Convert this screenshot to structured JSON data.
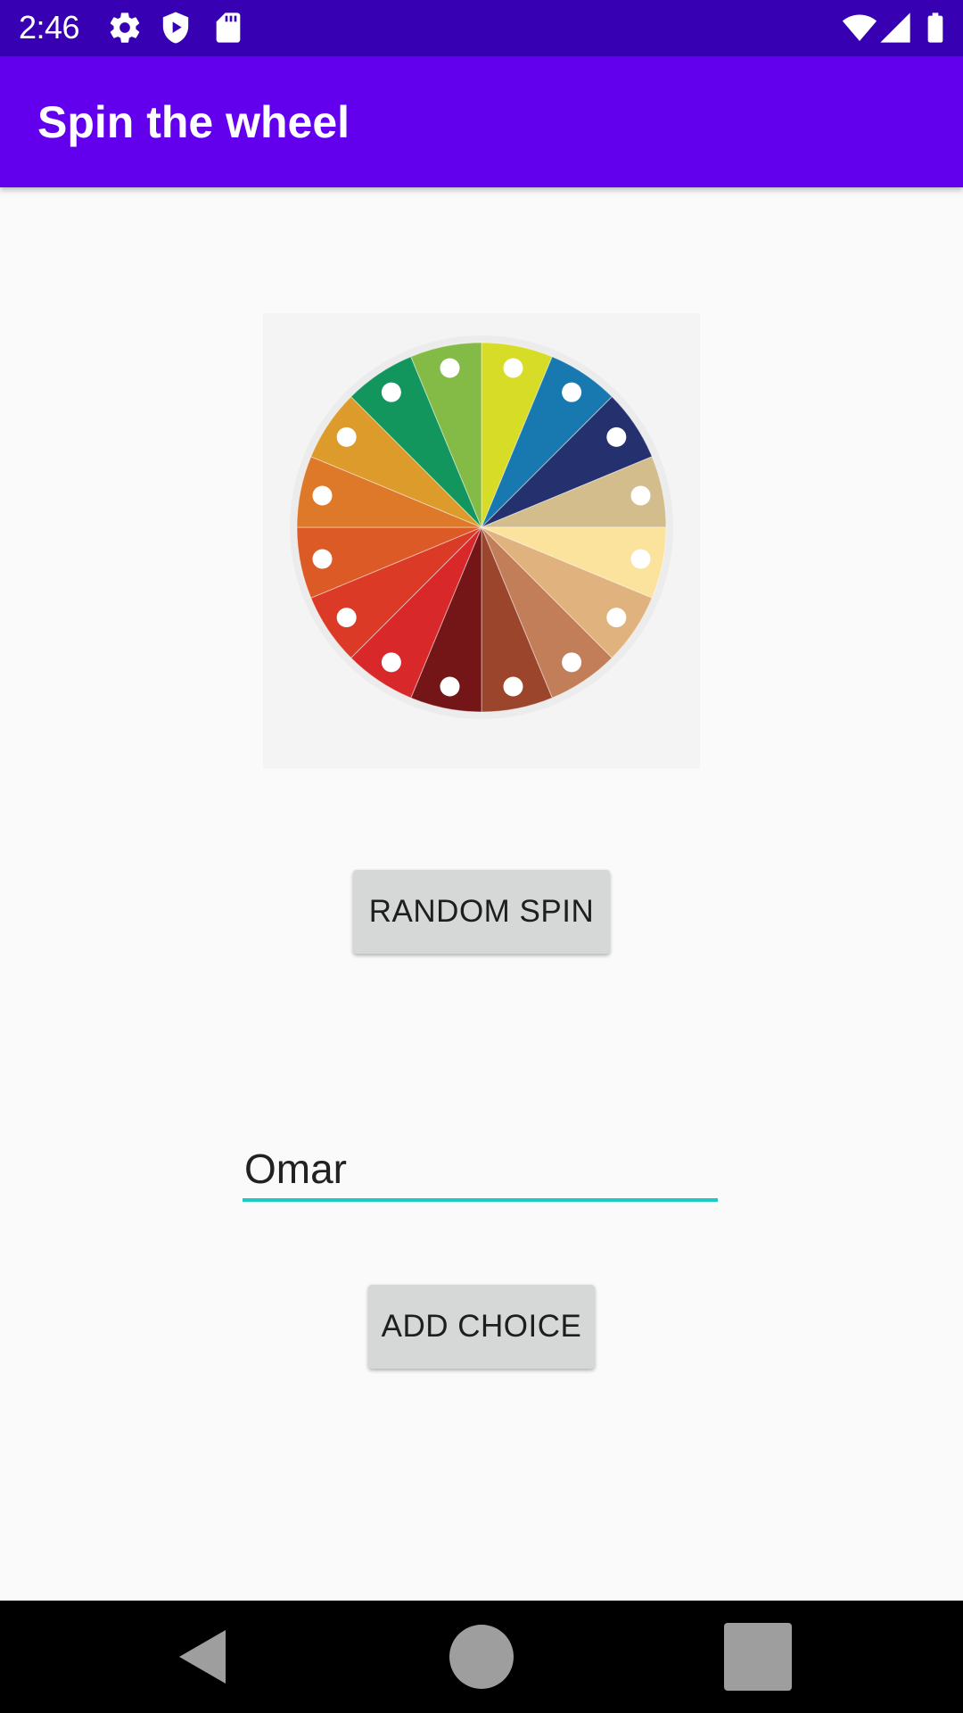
{
  "status_bar": {
    "time": "2:46",
    "icons": [
      "settings-icon",
      "play-protect-icon",
      "sd-card-icon",
      "wifi-icon",
      "signal-icon",
      "battery-icon"
    ]
  },
  "app_bar": {
    "title": "Spin the wheel"
  },
  "wheel": {
    "segment_count": 16,
    "segment_colors": [
      "#d7dc26",
      "#1879b0",
      "#25306e",
      "#d3bd8c",
      "#fbe29d",
      "#e0b27e",
      "#c17e58",
      "#9a452c",
      "#741517",
      "#d8282a",
      "#db3a27",
      "#dc5a26",
      "#de792a",
      "#dc9b2b",
      "#13965e",
      "#84bb47"
    ],
    "rim_color": "#ececec",
    "marker_color": "#ffffff"
  },
  "buttons": {
    "spin_label": "RANDOM SPIN",
    "add_label": "ADD CHOICE"
  },
  "choice_input": {
    "value": "Omar"
  },
  "nav_bar": {
    "back": "back-icon",
    "home": "home-icon",
    "recents": "recents-icon"
  },
  "colors": {
    "status_bar": "#3700b3",
    "app_bar": "#6200ee",
    "input_underline": "#1ccbc3",
    "button_bg": "#d6d7d7"
  }
}
